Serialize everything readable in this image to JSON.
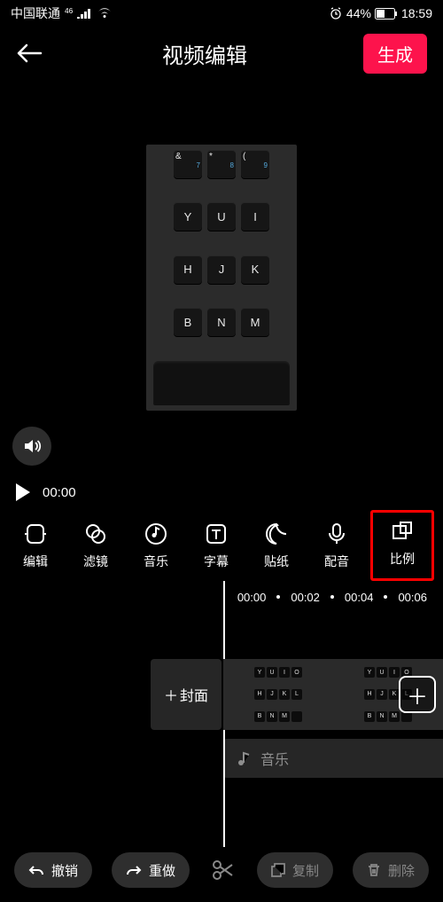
{
  "status": {
    "carrier": "中国联通",
    "network": "46",
    "battery_pct": "44%",
    "time": "18:59"
  },
  "nav": {
    "title": "视频编辑",
    "generate": "生成"
  },
  "preview": {
    "keys_row1": [
      "&",
      "*",
      "("
    ],
    "keys_row1_num": [
      "7",
      "8",
      "9"
    ],
    "keys_row2": [
      "Y",
      "U",
      "I"
    ],
    "keys_row3": [
      "H",
      "J",
      "K"
    ],
    "keys_row4": [
      "B",
      "N",
      "M"
    ]
  },
  "player": {
    "time": "00:00"
  },
  "toolbar": {
    "edit": "编辑",
    "filter": "滤镜",
    "music": "音乐",
    "subtitle": "字幕",
    "sticker": "贴纸",
    "voice": "配音",
    "ratio": "比例"
  },
  "timeline": {
    "marks": [
      "00:00",
      "00:02",
      "00:04",
      "00:06"
    ],
    "cover": "封面",
    "music_label": "音乐"
  },
  "bottom": {
    "undo": "撤销",
    "redo": "重做",
    "copy": "复制",
    "delete": "删除"
  }
}
